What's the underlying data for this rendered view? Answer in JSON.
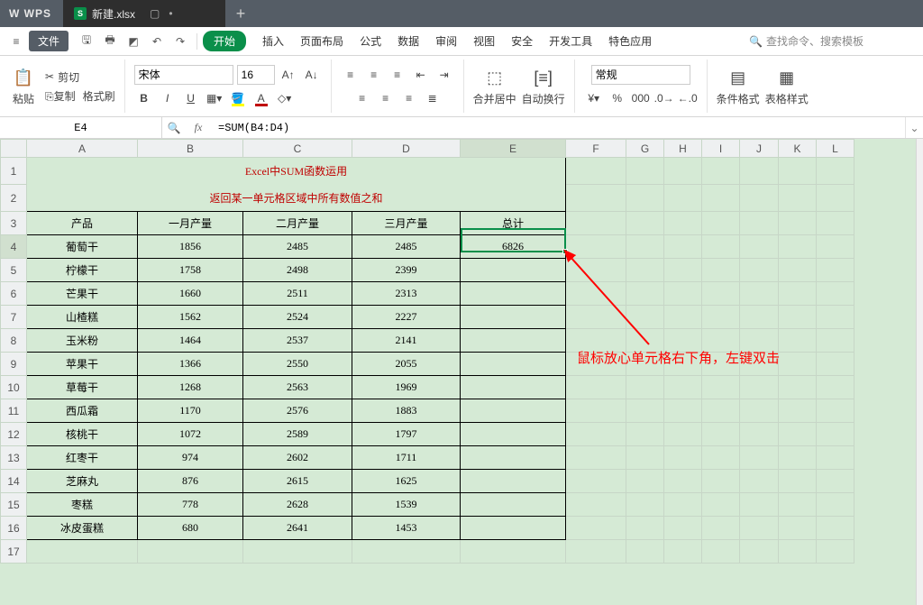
{
  "app": {
    "logo": "W WPS",
    "doc_name": "新建.xlsx",
    "doc_type_letter": "S",
    "add_tab": "+"
  },
  "menubar": {
    "file": "文件",
    "start": "开始",
    "items": [
      "插入",
      "页面布局",
      "公式",
      "数据",
      "审阅",
      "视图",
      "安全",
      "开发工具",
      "特色应用"
    ],
    "search_placeholder": "查找命令、搜索模板"
  },
  "ribbon": {
    "paste": "粘贴",
    "cut": "剪切",
    "copy": "复制",
    "format_painter": "格式刷",
    "font_name": "宋体",
    "font_size": "16",
    "merge_center": "合并居中",
    "wrap_text": "自动换行",
    "number_format": "常规",
    "cond_format": "条件格式",
    "table_style": "表格样式"
  },
  "formula_bar": {
    "cell_ref": "E4",
    "formula": "=SUM(B4:D4)",
    "fx": "fx"
  },
  "columns": [
    "A",
    "B",
    "C",
    "D",
    "E",
    "F",
    "G",
    "H",
    "I",
    "J",
    "K",
    "L"
  ],
  "table": {
    "title": "Excel中SUM函数运用",
    "subtitle": "返回某一单元格区域中所有数值之和",
    "headers": [
      "产品",
      "一月产量",
      "二月产量",
      "三月产量",
      "总计"
    ],
    "rows": [
      {
        "name": "葡萄干",
        "m1": "1856",
        "m2": "2485",
        "m3": "2485",
        "total": "6826"
      },
      {
        "name": "柠檬干",
        "m1": "1758",
        "m2": "2498",
        "m3": "2399",
        "total": ""
      },
      {
        "name": "芒果干",
        "m1": "1660",
        "m2": "2511",
        "m3": "2313",
        "total": ""
      },
      {
        "name": "山楂糕",
        "m1": "1562",
        "m2": "2524",
        "m3": "2227",
        "total": ""
      },
      {
        "name": "玉米粉",
        "m1": "1464",
        "m2": "2537",
        "m3": "2141",
        "total": ""
      },
      {
        "name": "苹果干",
        "m1": "1366",
        "m2": "2550",
        "m3": "2055",
        "total": ""
      },
      {
        "name": "草莓干",
        "m1": "1268",
        "m2": "2563",
        "m3": "1969",
        "total": ""
      },
      {
        "name": "西瓜霜",
        "m1": "1170",
        "m2": "2576",
        "m3": "1883",
        "total": ""
      },
      {
        "name": "核桃干",
        "m1": "1072",
        "m2": "2589",
        "m3": "1797",
        "total": ""
      },
      {
        "name": "红枣干",
        "m1": "974",
        "m2": "2602",
        "m3": "1711",
        "total": ""
      },
      {
        "name": "芝麻丸",
        "m1": "876",
        "m2": "2615",
        "m3": "1625",
        "total": ""
      },
      {
        "name": "枣糕",
        "m1": "778",
        "m2": "2628",
        "m3": "1539",
        "total": ""
      },
      {
        "name": "冰皮蛋糕",
        "m1": "680",
        "m2": "2641",
        "m3": "1453",
        "total": ""
      }
    ]
  },
  "annotation": "鼠标放心单元格右下角，左键双击"
}
